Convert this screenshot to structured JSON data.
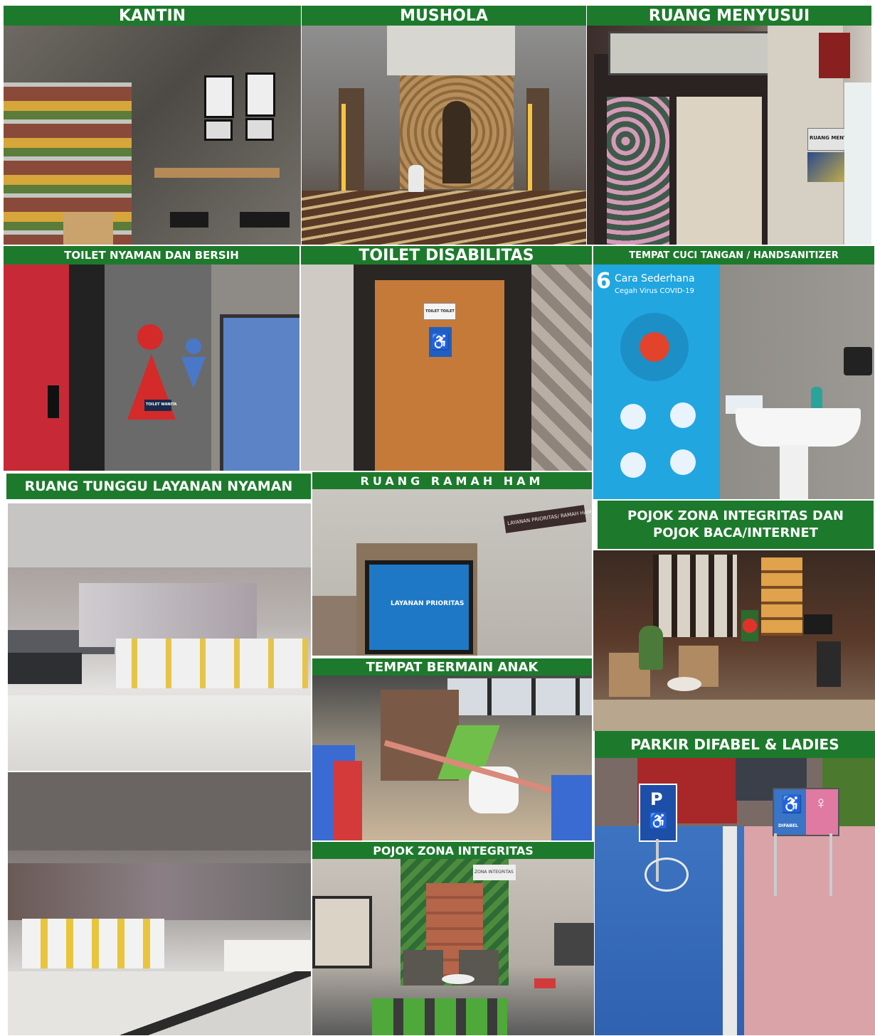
{
  "colors": {
    "banner_green": "#1d7a2c",
    "banner_text": "#ffffff"
  },
  "banners": {
    "kantin": "KANTIN",
    "mushola": "MUSHOLA",
    "ruang_menyusui": "RUANG MENYUSUI",
    "toilet_nyaman": "TOILET NYAMAN DAN BERSIH",
    "toilet_disabilitas": "TOILET DISABILITAS",
    "cuci_tangan": "TEMPAT CUCI TANGAN / HANDSANITIZER",
    "ruang_tunggu": "RUANG TUNGGU LAYANAN NYAMAN",
    "ruang_ramah_ham": "RUANG RAMAH HAM",
    "pojok_zi_baca_line1": "POJOK ZONA INTEGRITAS DAN",
    "pojok_zi_baca_line2": "POJOK BACA/INTERNET",
    "bermain_anak": "TEMPAT BERMAIN ANAK",
    "pojok_zi": "POJOK ZONA INTEGRITAS",
    "parkir": "PARKIR DIFABEL & LADIES"
  },
  "signs": {
    "poster_number": "6",
    "poster_title": "Cara Sederhana",
    "poster_subtitle": "Cegah Virus COVID-19",
    "ruang_menyusui_sign": "RUANG MENYUSUI",
    "toilet_wanita_sign": "TOILET WANITA",
    "toilet_door_sign": "TOILET  TOILET",
    "difabel_sign": "DIFABEL",
    "layanan_prioritas_sign": "LAYANAN PRIORITAS/ RAMAH HAM",
    "layanan_prioritas_screen": "LAYANAN PRIORITAS",
    "zona_integritas_wall": "ZONA INTEGRITAS",
    "parking_p": "P"
  }
}
